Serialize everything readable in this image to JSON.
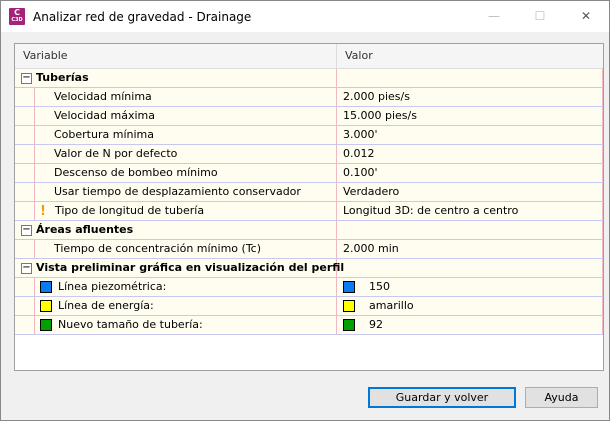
{
  "window": {
    "title": "Analizar red de gravedad - Drainage",
    "app_icon": "C",
    "app_icon_sub": "C3D",
    "minimize": "—",
    "maximize": "☐",
    "close": "✕"
  },
  "grid": {
    "headers": {
      "variable": "Variable",
      "value": "Valor"
    },
    "groups": [
      {
        "label": "Tuberías",
        "rows": [
          {
            "name": "Velocidad mínima",
            "value": "2.000 pies/s"
          },
          {
            "name": "Velocidad máxima",
            "value": "15.000 pies/s"
          },
          {
            "name": "Cobertura mínima",
            "value": "3.000'"
          },
          {
            "name": "Valor de N por defecto",
            "value": "0.012"
          },
          {
            "name": "Descenso de bombeo mínimo",
            "value": "0.100'"
          },
          {
            "name": "Usar tiempo de desplazamiento conservador",
            "value": "Verdadero"
          },
          {
            "name": "Tipo de longitud de tubería",
            "value": "Longitud 3D: de centro a centro",
            "icon": "warning-icon"
          }
        ]
      },
      {
        "label": "Áreas afluentes",
        "rows": [
          {
            "name": "Tiempo de concentración mínimo (Tc)",
            "value": "2.000 min"
          }
        ]
      },
      {
        "label": "Vista preliminar gráfica en visualización del perfil",
        "rows": [
          {
            "name": "Línea piezométrica:",
            "value": "150",
            "color": "#0a7cf0"
          },
          {
            "name": "Línea de energía:",
            "value": "amarillo",
            "color": "#ffff00"
          },
          {
            "name": "Nuevo tamaño de tubería:",
            "value": "92",
            "color": "#00a000"
          }
        ]
      }
    ]
  },
  "buttons": {
    "save": "Guardar y volver",
    "help": "Ayuda"
  }
}
